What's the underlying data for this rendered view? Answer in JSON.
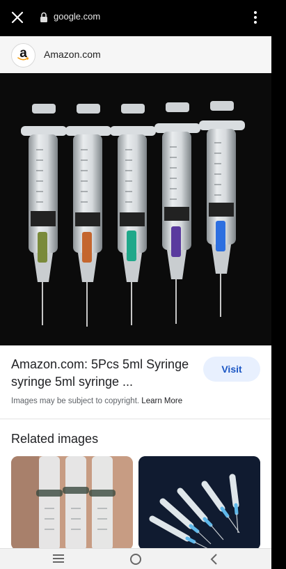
{
  "browser": {
    "url": "google.com",
    "close_icon": "close-icon",
    "lock_icon": "lock-icon",
    "menu_icon": "more-vert-icon"
  },
  "source": {
    "logo_letter": "a",
    "name": "Amazon.com"
  },
  "result": {
    "title": "Amazon.com: 5Pcs 5ml Syringe syringe 5ml syringe ...",
    "visit_label": "Visit",
    "copyright_text": "Images may be subject to copyright.",
    "learn_more": "Learn More"
  },
  "related": {
    "title": "Related images"
  },
  "nav": {
    "recent_icon": "recent-apps-icon",
    "home_icon": "home-icon",
    "back_icon": "back-icon"
  },
  "colors": {
    "visit_bg": "#e8f0fe",
    "visit_text": "#1a56c4",
    "needle_hubs": [
      "#7a8a3a",
      "#c4662e",
      "#1fa88a",
      "#5a3a9e",
      "#2d6fe0"
    ]
  }
}
